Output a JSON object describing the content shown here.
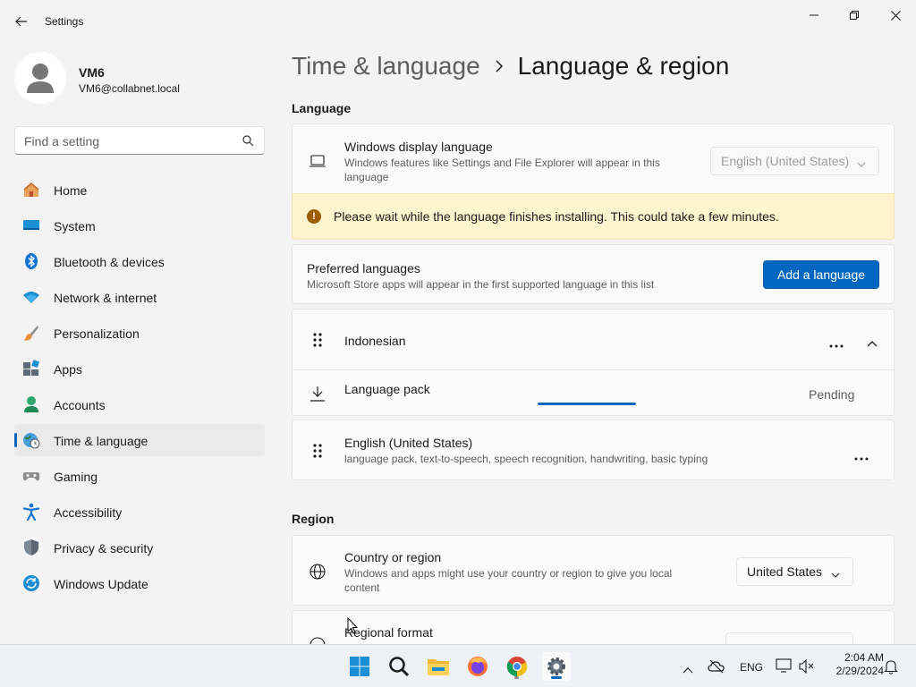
{
  "window": {
    "title": "Settings"
  },
  "profile": {
    "name": "VM6",
    "email": "VM6@collabnet.local"
  },
  "search": {
    "placeholder": "Find a setting"
  },
  "sidebar": {
    "items": [
      {
        "label": "Home",
        "icon": "home-icon"
      },
      {
        "label": "System",
        "icon": "system-icon"
      },
      {
        "label": "Bluetooth & devices",
        "icon": "bluetooth-icon"
      },
      {
        "label": "Network & internet",
        "icon": "wifi-icon"
      },
      {
        "label": "Personalization",
        "icon": "brush-icon"
      },
      {
        "label": "Apps",
        "icon": "apps-icon"
      },
      {
        "label": "Accounts",
        "icon": "accounts-icon"
      },
      {
        "label": "Time & language",
        "icon": "time-language-icon",
        "active": true
      },
      {
        "label": "Gaming",
        "icon": "gaming-icon"
      },
      {
        "label": "Accessibility",
        "icon": "accessibility-icon"
      },
      {
        "label": "Privacy & security",
        "icon": "shield-icon"
      },
      {
        "label": "Windows Update",
        "icon": "update-icon"
      }
    ]
  },
  "breadcrumb": {
    "parent": "Time & language",
    "current": "Language & region"
  },
  "language": {
    "section_title": "Language",
    "display_language": {
      "title": "Windows display language",
      "description": "Windows features like Settings and File Explorer will appear in this language",
      "value": "English (United States)"
    },
    "warning": "Please wait while the language finishes installing. This could take a few minutes.",
    "preferred": {
      "title": "Preferred languages",
      "description": "Microsoft Store apps will appear in the first supported language in this list",
      "add_button": "Add a language"
    },
    "languages": [
      {
        "name": "Indonesian",
        "expanded": true
      },
      {
        "name": "English (United States)",
        "description": "language pack, text-to-speech, speech recognition, handwriting, basic typing"
      }
    ],
    "language_pack": {
      "label": "Language pack",
      "status": "Pending",
      "progress": 0.6
    }
  },
  "region": {
    "section_title": "Region",
    "country": {
      "title": "Country or region",
      "description": "Windows and apps might use your country or region to give you local content",
      "value": "United States"
    },
    "format": {
      "title": "Regional format"
    }
  },
  "taskbar": {
    "input_language": "ENG",
    "time": "2:04 AM",
    "date": "2/29/2024"
  },
  "colors": {
    "accent": "#0067c0",
    "warning_bg": "#fff4ce"
  }
}
